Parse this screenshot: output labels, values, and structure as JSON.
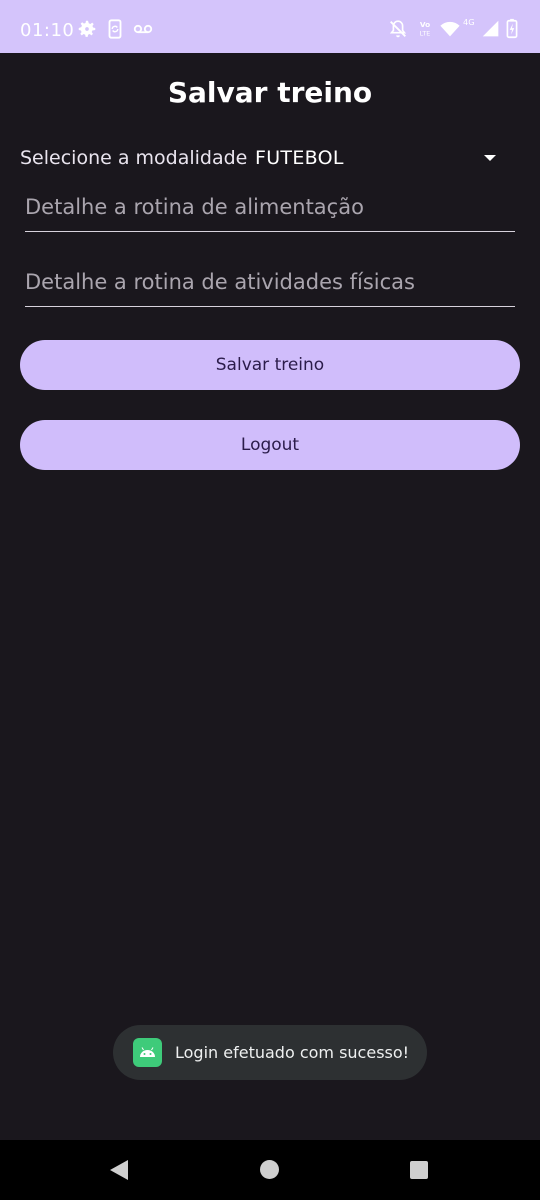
{
  "status_bar": {
    "time": "01:10",
    "icons": [
      "settings-gear-icon",
      "screenshot-sync-icon",
      "voicemail-icon",
      "notifications-muted-icon",
      "volte-icon",
      "wifi-icon",
      "signal-icon",
      "battery-charging-icon"
    ],
    "volte_label": "Vo LTE",
    "network_label": "4G"
  },
  "app": {
    "title": "Salvar treino",
    "modality_label": "Selecione a modalidade",
    "modality_value": "FUTEBOL",
    "food_placeholder": "Detalhe a rotina de alimentação",
    "activity_placeholder": "Detalhe a rotina de atividades físicas",
    "save_button": "Salvar treino",
    "logout_button": "Logout"
  },
  "toast": {
    "icon": "android-app-icon",
    "message": "Login efetuado com sucesso!"
  },
  "navigation": {
    "buttons": [
      "back-icon",
      "home-icon",
      "recents-icon"
    ]
  },
  "colors": {
    "status_bar": "#d4c4fb",
    "background": "#1a171d",
    "button": "#d0bdfb",
    "button_text": "#2b1c4a",
    "toast_bg": "#2d3032",
    "toast_icon": "#3ecb7a"
  }
}
